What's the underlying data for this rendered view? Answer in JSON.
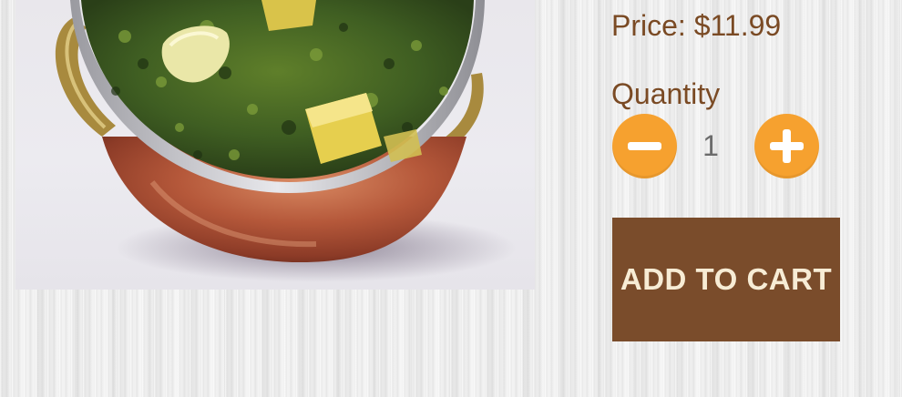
{
  "product": {
    "image_alt": "Bowl of saag paneer in a copper kadai",
    "price_text": "Price: $11.99"
  },
  "quantity": {
    "label": "Quantity",
    "value": "1",
    "decrement_icon": "minus-icon",
    "increment_icon": "plus-icon"
  },
  "cart": {
    "add_label": "ADD TO CART"
  },
  "colors": {
    "text_brown": "#7a4a24",
    "button_brown": "#7a4c2b",
    "button_text": "#f7ecd5",
    "accent_orange": "#f6a12f",
    "quantity_text": "#6b6b6b"
  }
}
